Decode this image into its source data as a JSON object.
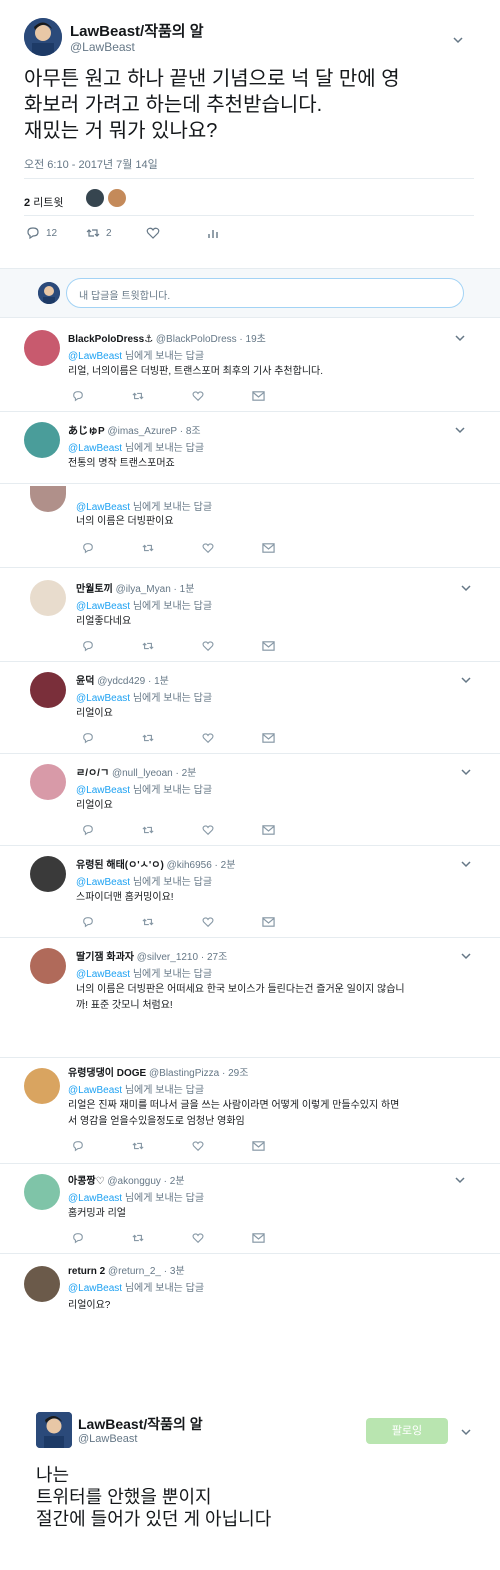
{
  "main_tweet": {
    "display_name": "LawBeast/작품의 알",
    "handle": "@LawBeast",
    "text": "아무튼 원고 하나 끝낸 기념으로 넉 달 만에 영\n화보러 가려고 하는데 추천받습니다.\n재밌는 거 뭐가 있나요?",
    "timestamp": "오전 6:10 - 2017년 7월 14일",
    "retweet_count": "2",
    "retweet_label": "리트윗",
    "reply_count": "12",
    "rt_count": "2",
    "avatar_color": "#2b4a7a"
  },
  "reply_box": {
    "placeholder": "내 답글을 트윗합니다."
  },
  "reply_to_text": "님에게 보내는 답글",
  "reply_to_link": "@LawBeast",
  "replies": [
    {
      "name": "BlackPoloDress⚓",
      "handle": "@BlackPoloDress",
      "time": "19초",
      "text": "리얼, 너의이름은 더빙판, 트랜스포머 최후의 기사 추천합니다.",
      "avatar_color": "#c85a6e"
    },
    {
      "name": "あじゅP",
      "handle": "@imas_AzureP",
      "time": "8조",
      "text": "전통의 명작 트랜스포머죠",
      "avatar_color": "#4a9d9a"
    },
    {
      "name": "",
      "handle": "",
      "time": "",
      "text": "너의 이름은 더빙판이요",
      "avatar_color": "#b0908a"
    },
    {
      "name": "만월토끼",
      "handle": "@ilya_Myan",
      "time": "1분",
      "text": "리얼좋다네요",
      "avatar_color": "#e8dccd"
    },
    {
      "name": "윤덕",
      "handle": "@ydcd429",
      "time": "1분",
      "text": "리얼이요",
      "avatar_color": "#7a2f3a"
    },
    {
      "name": "ㄹ/ㅇ/ㄱ",
      "handle": "@null_lyeoan",
      "time": "2분",
      "text": "리얼이요",
      "avatar_color": "#d89aa8"
    },
    {
      "name": "유령된 해태(ㅇ'ㅅ'ㅇ)",
      "handle": "@kih6956",
      "time": "2분",
      "text": "스파이더맨 홈커밍이요!",
      "avatar_color": "#3a3a3a"
    },
    {
      "name": "딸기잼 화과자",
      "handle": "@silver_1210",
      "time": "27조",
      "text": "너의 이름은 더빙판은 어떠세요 한국 보이스가 들린다는건 즐거운 일이지 않습니\n까! 표준 갓모니 처럼요!",
      "avatar_color": "#b06a5a"
    },
    {
      "name": "유령댕댕이 DOGE",
      "handle": "@BlastingPizza",
      "time": "29조",
      "text": "리얼은 진짜 재미를 떠나서 글을 쓰는 사람이라면 어떻게 이렇게 만들수있지 하면\n서 영감을 얻을수있을정도로 엄청난 영화임",
      "avatar_color": "#d9a460"
    },
    {
      "name": "아콩짱♡",
      "handle": "@akongguy",
      "time": "2분",
      "text": "홈커밍과 리얼",
      "avatar_color": "#7fc4a8"
    },
    {
      "name": "return 2",
      "handle": "@return_2_",
      "time": "3분",
      "text": "리얼이요?",
      "avatar_color": "#6b5a4a"
    }
  ],
  "bottom_tweet": {
    "display_name": "LawBeast/작품의 알",
    "handle": "@LawBeast",
    "follow_label": "팔로잉",
    "text": "나는\n트위터를 안했을 뿐이지\n절간에 들어가 있던 게 아닙니다"
  }
}
